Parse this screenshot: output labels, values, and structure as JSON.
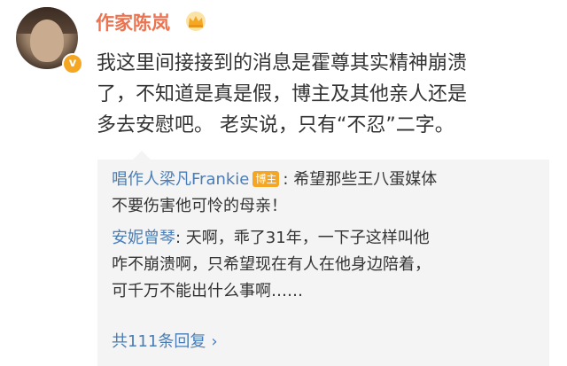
{
  "post": {
    "author": "作家陈岚",
    "verified_badge": "v",
    "lines": [
      "我这里间接接到的消息是霍尊其实精神崩溃",
      "了，不知道是真是假，博主及其他亲人还是",
      "多去安慰吧。 老实说，只有“不忍”二字。"
    ]
  },
  "replies": [
    {
      "name": "唱作人梁凡Frankie",
      "badge": "博主",
      "separator": ": ",
      "lines": [
        "希望那些王八蛋媒体",
        "不要伤害他可怜的母亲！"
      ]
    },
    {
      "name": "安妮曾琴",
      "separator": ": ",
      "lines": [
        "天啊，乖了31年，一下子这样叫他",
        "咋不崩溃啊，只希望现在有人在他身边陪着，",
        "可千万不能出什么事啊……"
      ]
    }
  ],
  "more_replies": {
    "label": "共111条回复",
    "chevron": "›"
  },
  "colors": {
    "author": "#eb7350",
    "link": "#4a7db5",
    "text": "#333333",
    "reply_bg": "#f4f4f4",
    "badge": "#f5a623"
  },
  "icons": [
    "avatar",
    "verified-v-icon",
    "crown-icon",
    "chevron-right-icon"
  ]
}
